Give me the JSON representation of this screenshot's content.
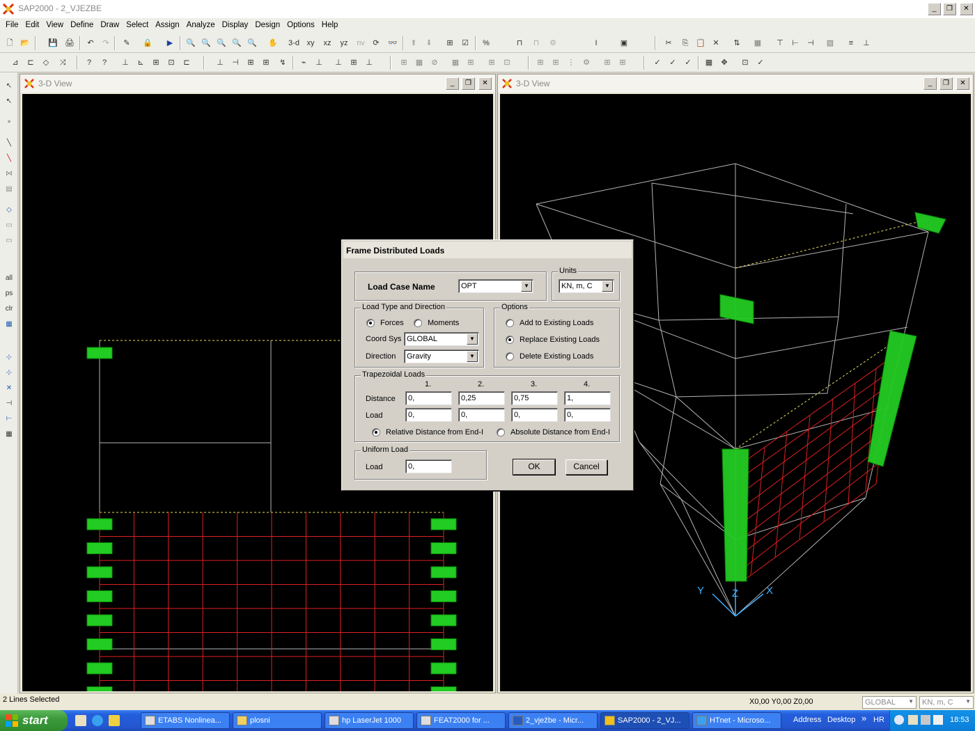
{
  "window": {
    "title": "SAP2000 - 2_VJEZBE",
    "min_glyph": "_",
    "max_glyph": "❐",
    "close_glyph": "✕"
  },
  "menu": [
    "File",
    "Edit",
    "View",
    "Define",
    "Draw",
    "Select",
    "Assign",
    "Analyze",
    "Display",
    "Design",
    "Options",
    "Help"
  ],
  "toolbar1": {
    "view_buttons": [
      "3-d",
      "xy",
      "xz",
      "yz",
      "nv"
    ]
  },
  "left_toolbar": {
    "labels": [
      "all",
      "ps",
      "clr"
    ]
  },
  "views": {
    "left": {
      "title": "3-D View"
    },
    "right": {
      "title": "3-D View"
    }
  },
  "axes": {
    "y": "Y",
    "z": "Z",
    "x": "X"
  },
  "dialog": {
    "title": "Frame Distributed Loads",
    "load_case_label": "Load Case Name",
    "load_case_value": "OPT",
    "units_label": "Units",
    "units_value": "KN, m, C",
    "load_type_group": "Load Type and Direction",
    "forces_label": "Forces",
    "moments_label": "Moments",
    "coord_sys_label": "Coord Sys",
    "coord_sys_value": "GLOBAL",
    "direction_label": "Direction",
    "direction_value": "Gravity",
    "options_group": "Options",
    "option_add": "Add to Existing Loads",
    "option_replace": "Replace Existing Loads",
    "option_delete": "Delete Existing Loads",
    "selected_option": "replace",
    "selected_load_type": "forces",
    "trap_group": "Trapezoidal Loads",
    "trap_columns": [
      "1.",
      "2.",
      "3.",
      "4."
    ],
    "distance_label": "Distance",
    "distances": [
      "0,",
      "0,25",
      "0,75",
      "1,"
    ],
    "load_label": "Load",
    "loads": [
      "0,",
      "0,",
      "0,",
      "0,"
    ],
    "relative_label": "Relative Distance from End-I",
    "absolute_label": "Absolute Distance from End-I",
    "selected_distance_mode": "relative",
    "uniform_group": "Uniform Load",
    "uniform_load_label": "Load",
    "uniform_load_value": "0,",
    "ok_label": "OK",
    "cancel_label": "Cancel"
  },
  "status": {
    "message": "2 Lines Selected",
    "coords": "X0,00  Y0,00  Z0,00",
    "coord_sys": "GLOBAL",
    "units": "KN, m, C"
  },
  "taskbar": {
    "start_label": "start",
    "tasks": [
      "ETABS Nonlinea...",
      "plosni",
      "hp LaserJet 1000",
      "FEAT2000 for ...",
      "2_vježbe - Micr...",
      "SAP2000 - 2_VJ...",
      "HTnet - Microso..."
    ],
    "address_label": "Address",
    "desktop_label": "Desktop",
    "more_glyph": "»",
    "lang": "HR",
    "clock": "18:53"
  },
  "colors": {
    "canvas_bg": "#000000",
    "frame_lines": "#b4b4b4",
    "load_grid": "#e02020",
    "load_marker": "#22cc22",
    "selection_dashed": "#e8e060",
    "axis_color": "#40b0ff"
  }
}
